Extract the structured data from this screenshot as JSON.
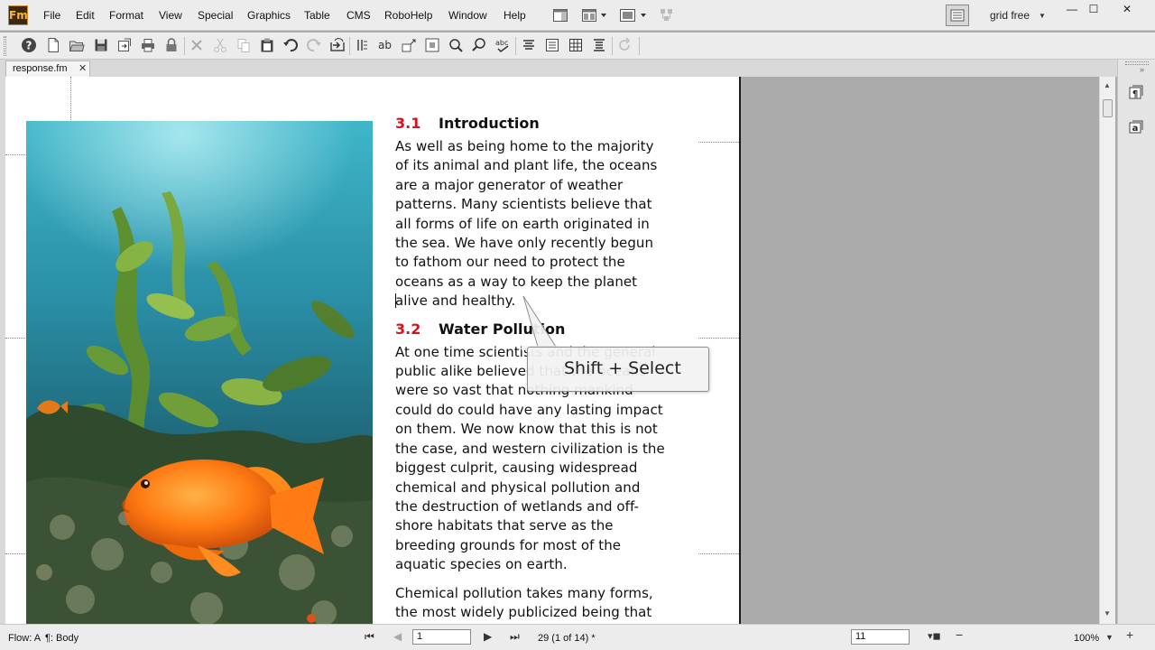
{
  "app": {
    "logo_text": "Fm"
  },
  "menu": [
    "File",
    "Edit",
    "Format",
    "View",
    "Special",
    "Graphics",
    "Table",
    "CMS",
    "RoboHelp",
    "Window",
    "Help"
  ],
  "workspace": {
    "label": "grid free"
  },
  "window_controls": {
    "minimize": "—",
    "maximize": "☐",
    "close": "✕"
  },
  "tab": {
    "label": "response.fm",
    "close": "✕"
  },
  "document": {
    "sections": [
      {
        "number": "3.1",
        "title": "Introduction",
        "paragraphs": [
          [
            "As well as being home to the majority",
            "of its animal and plant life, the oceans",
            "are a major generator of weather",
            "patterns. Many scientists believe that",
            "all forms of life on earth originated in",
            "the sea. We have only recently begun",
            "to fathom our need to protect the",
            "oceans as a way to keep the planet",
            "alive and healthy."
          ]
        ]
      },
      {
        "number": "3.2",
        "title": "Water Pollution",
        "paragraphs": [
          [
            "At one time scientists and the general",
            "public alike believed that the oceans",
            "were so vast that nothing mankind",
            "could do could have any lasting impact",
            "on them. We now know that this is not",
            "the case, and western civilization is the",
            "biggest culprit, causing widespread",
            "chemical and physical pollution and",
            "the destruction of wetlands and off-",
            "shore habitats that serve as the",
            "breeding grounds for most of the",
            "aquatic species on earth."
          ],
          [
            "Chemical pollution takes many forms,",
            "the most widely publicized being that"
          ]
        ]
      }
    ]
  },
  "callout": {
    "text": "Shift + Select"
  },
  "status": {
    "flow": "Flow: A",
    "paragraph_tag": "¶: Body",
    "page_input": "1",
    "page_info": "29 (1 of 14) *",
    "zoom_input": "11",
    "zoom": "100%"
  },
  "colors": {
    "heading_number": "#d2131d",
    "chrome": "#ececec",
    "pasteboard": "#ababab"
  },
  "icons": {
    "toolbar": [
      "help-icon",
      "new-icon",
      "open-icon",
      "save-icon",
      "save-as-icon",
      "print-icon",
      "lock-icon",
      "delete-icon",
      "cut-icon",
      "copy-icon",
      "paste-icon",
      "undo-icon",
      "redo-icon",
      "import-icon",
      "track-changes-icon",
      "spelling-icon",
      "paragraph-designer-icon",
      "character-designer-icon",
      "find-icon",
      "zoom-icon",
      "thesaurus-icon",
      "align-center-icon",
      "align-justify-icon",
      "table-icon",
      "insert-table-icon",
      "refresh-icon"
    ],
    "right_panel": [
      "paragraph-catalog-icon",
      "character-catalog-icon"
    ]
  }
}
